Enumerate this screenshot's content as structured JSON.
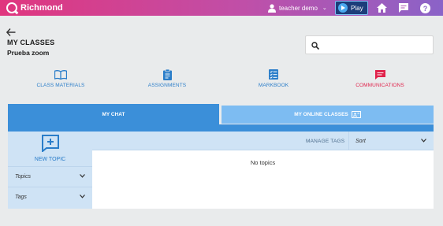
{
  "topbar": {
    "brand": "Richmond",
    "user_name": "teacher demo",
    "play_label": "Play",
    "gradient": [
      "#e0367e",
      "#8a63c8"
    ]
  },
  "header": {
    "title": "MY CLASSES",
    "class_name": "Prueba zoom",
    "search_placeholder": ""
  },
  "nav": {
    "items": [
      {
        "label": "CLASS MATERIALS",
        "icon": "book-icon"
      },
      {
        "label": "ASSIGNMENTS",
        "icon": "clipboard-icon"
      },
      {
        "label": "MARKBOOK",
        "icon": "checklist-icon"
      },
      {
        "label": "COMMUNICATIONS",
        "icon": "chat-icon",
        "active": true
      }
    ],
    "accent": "#2a7dc9",
    "active_color": "#e0214a"
  },
  "tabs": {
    "chat": "MY CHAT",
    "online": "MY ONLINE CLASSES"
  },
  "sidebar": {
    "new_topic": "NEW TOPIC",
    "topics": "Topics",
    "tags": "Tags"
  },
  "toolbar": {
    "manage_tags": "MANAGE TAGS",
    "sort": "Sort"
  },
  "content": {
    "empty": "No topics"
  }
}
